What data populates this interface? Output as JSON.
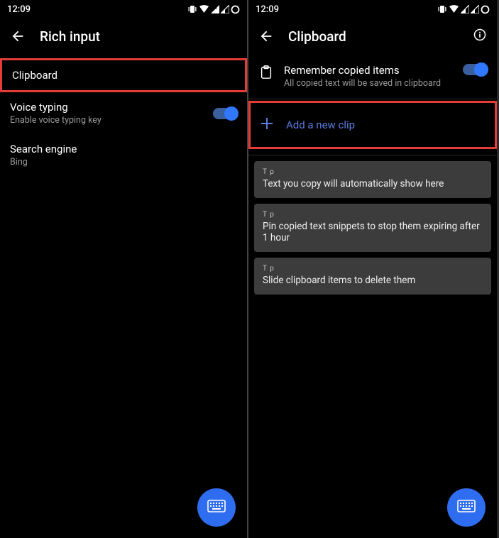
{
  "left": {
    "status": {
      "time": "12:09"
    },
    "title": "Rich input",
    "items": [
      {
        "label": "Clipboard"
      },
      {
        "label": "Voice typing",
        "sub": "Enable voice typing key",
        "toggle": true
      },
      {
        "label": "Search engine",
        "sub": "Bing"
      }
    ]
  },
  "right": {
    "status": {
      "time": "12:09"
    },
    "title": "Clipboard",
    "remember": {
      "label": "Remember copied items",
      "sub": "All copied text will be saved in clipboard"
    },
    "addclip": "Add a new clip",
    "tips": [
      {
        "tag": "T p",
        "msg": "Text you copy will automatically show here"
      },
      {
        "tag": "T p",
        "msg": "Pin copied text snippets to stop them expiring after 1 hour"
      },
      {
        "tag": "T p",
        "msg": "Slide clipboard items to delete them"
      }
    ]
  }
}
